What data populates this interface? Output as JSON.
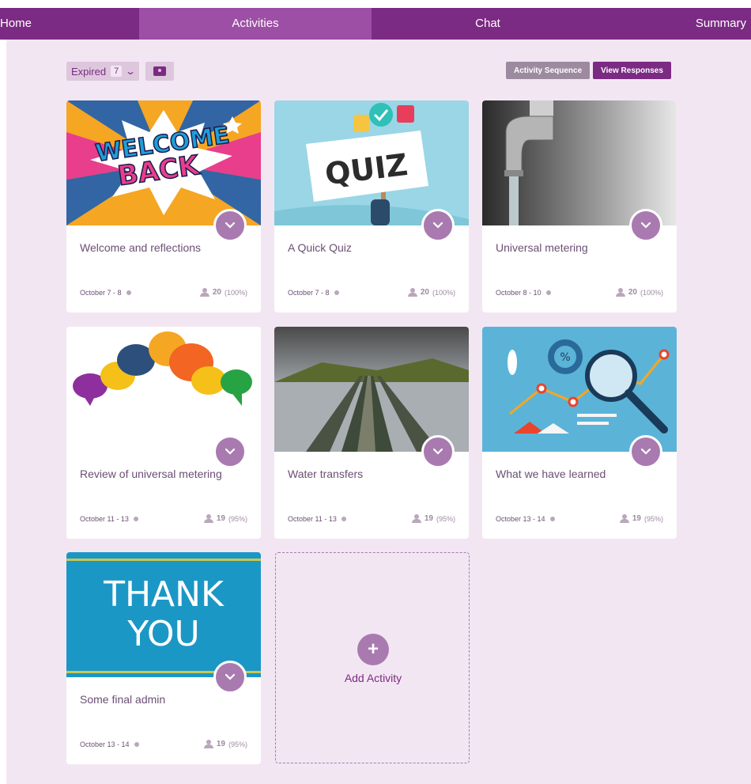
{
  "nav": {
    "tabs": [
      {
        "label": "Home"
      },
      {
        "label": "Activities",
        "active": true
      },
      {
        "label": "Chat"
      },
      {
        "label": "Summary"
      }
    ]
  },
  "toolbar": {
    "filter_label": "Expired",
    "filter_count": "7",
    "activity_sequence_label": "Activity Sequence",
    "view_responses_label": "View Responses"
  },
  "cards": [
    {
      "title": "Welcome and reflections",
      "dates": "October 7 - 8",
      "count": "20",
      "percent": "(100%)",
      "image_icon": "welcome-back-image"
    },
    {
      "title": "A Quick Quiz",
      "dates": "October 7 - 8",
      "count": "20",
      "percent": "(100%)",
      "image_icon": "quiz-sign-image",
      "image_text": "QUIZ"
    },
    {
      "title": "Universal metering",
      "dates": "October 8 - 10",
      "count": "20",
      "percent": "(100%)",
      "image_icon": "water-tap-image"
    },
    {
      "title": "Review of universal metering",
      "dates": "October 11 - 13",
      "count": "19",
      "percent": "(95%)",
      "image_icon": "speech-bubbles-image"
    },
    {
      "title": "Water transfers",
      "dates": "October 11 - 13",
      "count": "19",
      "percent": "(95%)",
      "image_icon": "pipeline-image"
    },
    {
      "title": "What we have learned",
      "dates": "October 13 - 14",
      "count": "19",
      "percent": "(95%)",
      "image_icon": "analytics-image"
    },
    {
      "title": "Some final admin",
      "dates": "October 13 - 14",
      "count": "19",
      "percent": "(95%)",
      "image_icon": "thank-you-image",
      "image_text_1": "THANK",
      "image_text_2": "YOU"
    }
  ],
  "add_activity_label": "Add Activity",
  "colors": {
    "brand": "#7b2b83",
    "background": "#f3e6f3",
    "accent": "#a97ab0"
  }
}
